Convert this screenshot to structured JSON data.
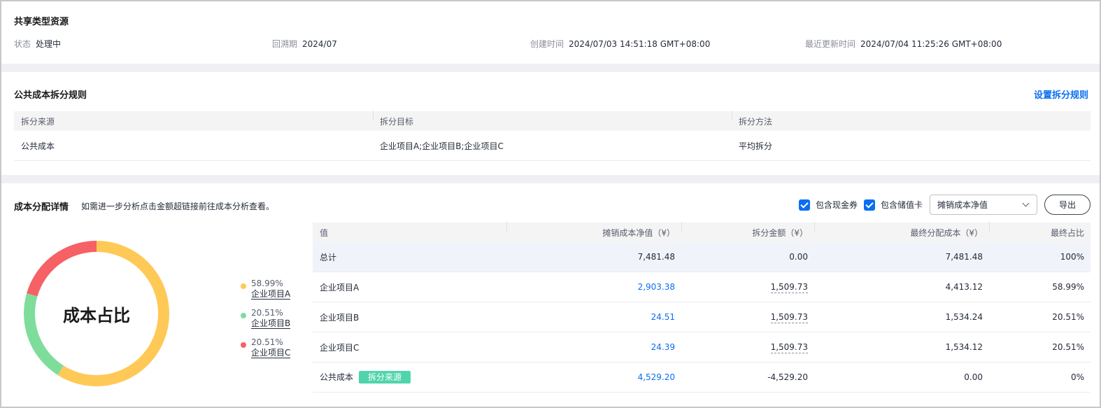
{
  "resource": {
    "title": "共享类型资源",
    "meta": [
      {
        "label": "状态",
        "value": "处理中"
      },
      {
        "label": "回溯期",
        "value": "2024/07"
      },
      {
        "label": "创建时间",
        "value": "2024/07/03 14:51:18 GMT+08:00"
      },
      {
        "label": "最近更新时间",
        "value": "2024/07/04 11:25:26 GMT+08:00"
      }
    ]
  },
  "rules": {
    "title": "公共成本拆分规则",
    "set_link": "设置拆分规则",
    "headers": [
      "拆分来源",
      "拆分目标",
      "拆分方法"
    ],
    "rows": [
      [
        "公共成本",
        "企业项目A;企业项目B;企业项目C",
        "平均拆分"
      ]
    ]
  },
  "detail": {
    "title": "成本分配详情",
    "description": "如需进一步分析点击金额超链接前往成本分析查看。",
    "checkbox_cash": "包含现金券",
    "checkbox_stored": "包含储值卡",
    "select_value": "摊销成本净值",
    "export": "导出",
    "donut_label": "成本占比",
    "legend": [
      {
        "pct": "58.99%",
        "name": "企业项目A",
        "color": "#ffc957"
      },
      {
        "pct": "20.51%",
        "name": "企业项目B",
        "color": "#7fdd9c"
      },
      {
        "pct": "20.51%",
        "name": "企业项目C",
        "color": "#f66166"
      }
    ],
    "headers": [
      "值",
      "摊销成本净值（¥）",
      "拆分金额（¥）",
      "最终分配成本（¥）",
      "最终占比"
    ],
    "rows": [
      {
        "name": "总计",
        "net": "7,481.48",
        "split": "0.00",
        "final": "7,481.48",
        "ratio": "100%"
      },
      {
        "name": "企业项目A",
        "net": "2,903.38",
        "split": "1,509.73",
        "final": "4,413.12",
        "ratio": "58.99%"
      },
      {
        "name": "企业项目B",
        "net": "24.51",
        "split": "1,509.73",
        "final": "1,534.24",
        "ratio": "20.51%"
      },
      {
        "name": "企业项目C",
        "net": "24.39",
        "split": "1,509.73",
        "final": "1,534.12",
        "ratio": "20.51%"
      },
      {
        "name": "公共成本",
        "tag": "拆分来源",
        "net": "4,529.20",
        "split": "-4,529.20",
        "final": "0.00",
        "ratio": "0%"
      }
    ]
  },
  "chart_data": {
    "type": "pie",
    "categories": [
      "企业项目A",
      "企业项目B",
      "企业项目C"
    ],
    "values": [
      58.99,
      20.51,
      20.51
    ]
  },
  "colors": {
    "accent": "#0a6ef2",
    "tag": "#50d4ab"
  }
}
